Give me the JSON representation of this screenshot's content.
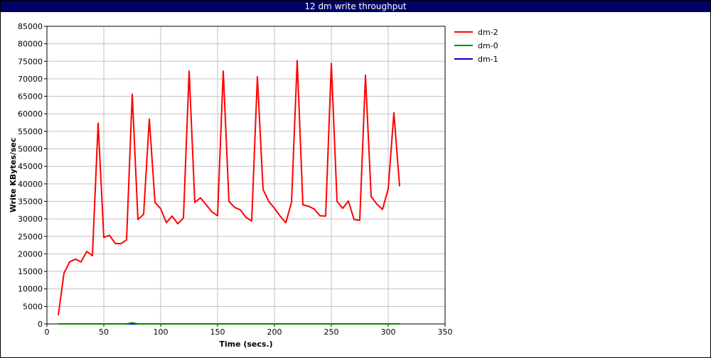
{
  "title": "12 dm write throughput",
  "chart_data": {
    "type": "line",
    "title": "12 dm write throughput",
    "xlabel": "Time (secs.)",
    "ylabel": "Write KBytes/sec",
    "xlim": [
      0,
      350
    ],
    "ylim": [
      0,
      85000
    ],
    "x_ticks": [
      "0",
      "50",
      "100",
      "150",
      "200",
      "250",
      "300",
      "350"
    ],
    "y_ticks": [
      "0",
      "5000",
      "10000",
      "15000",
      "20000",
      "25000",
      "30000",
      "35000",
      "40000",
      "45000",
      "50000",
      "55000",
      "60000",
      "65000",
      "70000",
      "75000",
      "80000",
      "85000"
    ],
    "grid": true,
    "legend_position": "top-right outside",
    "series": [
      {
        "name": "dm-2",
        "color": "#ff0000",
        "x": [
          10,
          15,
          20,
          25,
          30,
          35,
          40,
          45,
          50,
          55,
          60,
          65,
          70,
          75,
          80,
          85,
          90,
          95,
          100,
          105,
          110,
          115,
          120,
          125,
          130,
          135,
          140,
          145,
          150,
          155,
          160,
          165,
          170,
          175,
          180,
          185,
          190,
          195,
          200,
          205,
          210,
          215,
          220,
          225,
          230,
          235,
          240,
          245,
          250,
          255,
          260,
          265,
          270,
          275,
          280,
          285,
          290,
          295,
          300,
          305,
          310
        ],
        "y": [
          2500,
          14500,
          17700,
          18500,
          17700,
          20700,
          19500,
          57300,
          24700,
          25300,
          23000,
          22900,
          24000,
          65600,
          29800,
          31300,
          58500,
          34700,
          32900,
          28900,
          30800,
          28600,
          30200,
          72200,
          34700,
          36000,
          34000,
          32000,
          30900,
          72200,
          35000,
          33300,
          32600,
          30400,
          29400,
          70600,
          38400,
          35000,
          33000,
          30800,
          28900,
          34700,
          75200,
          34000,
          33600,
          32800,
          30900,
          30800,
          74400,
          35000,
          33000,
          35100,
          29800,
          29600,
          71000,
          36400,
          34200,
          32700,
          38600,
          60300,
          39300
        ]
      },
      {
        "name": "dm-0",
        "color": "#008800",
        "x": [
          10,
          40,
          70,
          75,
          80,
          120,
          200,
          250,
          300,
          310
        ],
        "y": [
          0,
          0,
          0,
          300,
          0,
          0,
          0,
          0,
          0,
          0
        ]
      },
      {
        "name": "dm-1",
        "color": "#0000cc",
        "x": [
          10,
          310
        ],
        "y": [
          0,
          0
        ]
      }
    ]
  }
}
